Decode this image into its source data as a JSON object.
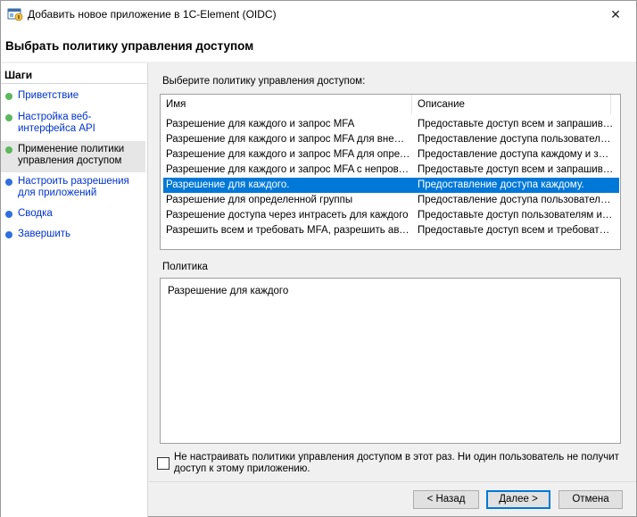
{
  "window": {
    "title": "Добавить новое приложение в 1C-Element (OIDC)",
    "close_symbol": "✕"
  },
  "page_title": "Выбрать политику управления доступом",
  "steps": {
    "header": "Шаги",
    "items": [
      {
        "label": "Приветствие",
        "status": "done",
        "color": "#5cb85c"
      },
      {
        "label": "Настройка веб-интерфейса API",
        "status": "done",
        "color": "#5cb85c"
      },
      {
        "label": "Применение политики управления доступом",
        "status": "current",
        "color": "#5cb85c"
      },
      {
        "label": "Настроить разрешения для приложений",
        "status": "pending",
        "color": "#2f6fde"
      },
      {
        "label": "Сводка",
        "status": "pending",
        "color": "#2f6fde"
      },
      {
        "label": "Завершить",
        "status": "pending",
        "color": "#2f6fde"
      }
    ]
  },
  "policy_list": {
    "label": "Выберите политику управления доступом:",
    "columns": [
      "Имя",
      "Описание"
    ],
    "rows": [
      {
        "name": "Разрешение для каждого и запрос MFA",
        "description": "Предоставьте доступ всем и запрашиваю..."
      },
      {
        "name": "Разрешение для каждого и запрос MFA для внешн...",
        "description": "Предоставление доступа пользователям..."
      },
      {
        "name": "Разрешение для каждого и запрос MFA для опреде...",
        "description": "Предоставление доступа каждому и зап..."
      },
      {
        "name": "Разрешение для каждого и запрос MFA с непровер...",
        "description": "Предоставьте доступ всем и запрашива..."
      },
      {
        "name": "Разрешение для каждого.",
        "description": "Предоставление доступа каждому."
      },
      {
        "name": "Разрешение для определенной группы",
        "description": "Предоставление доступа пользователям..."
      },
      {
        "name": "Разрешение доступа через интрасеть для каждого",
        "description": "Предоставьте доступ пользователям инт..."
      },
      {
        "name": "Разрешить всем и требовать MFA, разрешить авто...",
        "description": "Предоставьте доступ всем и требовать ..."
      }
    ],
    "selected_index": 4
  },
  "policy": {
    "label": "Политика",
    "text": "Разрешение для каждого"
  },
  "skip_checkbox": {
    "label": "Не настраивать политики управления доступом в этот раз. Ни один пользователь не получит доступ к этому приложению.",
    "checked": false
  },
  "buttons": {
    "back": "< Назад",
    "next": "Далее >",
    "cancel": "Отмена"
  }
}
